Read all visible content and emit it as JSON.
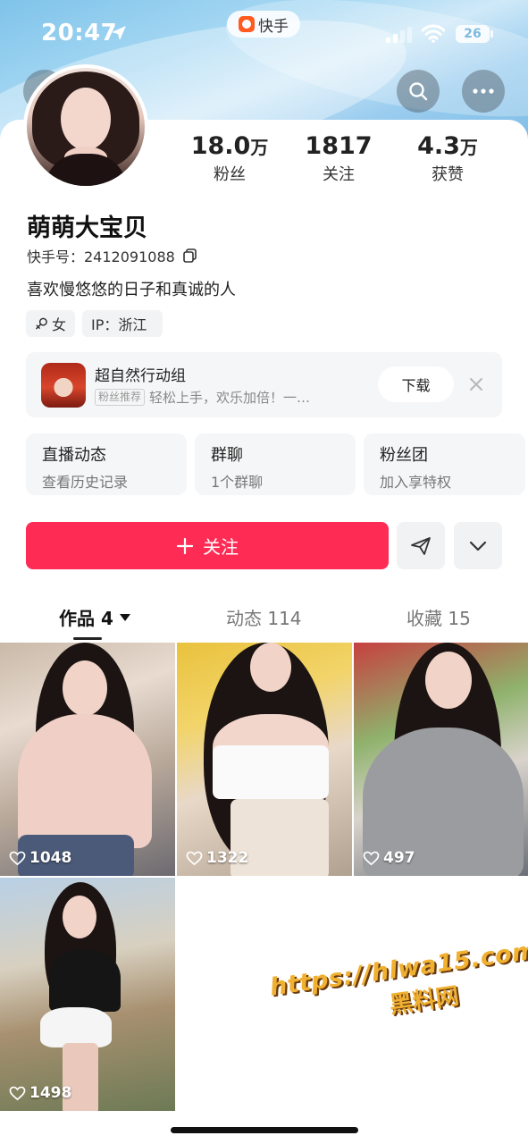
{
  "status_bar": {
    "time": "20:47",
    "app_name": "快手",
    "battery": "26",
    "icons": [
      "location-arrow-icon",
      "signal-icon",
      "wifi-icon",
      "battery-icon"
    ]
  },
  "header": {
    "icons": [
      "back-icon",
      "search-icon",
      "more-icon"
    ]
  },
  "profile": {
    "stats": [
      {
        "value": "18.0",
        "unit": "万",
        "label": "粉丝"
      },
      {
        "value": "1817",
        "unit": "",
        "label": "关注"
      },
      {
        "value": "4.3",
        "unit": "万",
        "label": "获赞"
      }
    ],
    "username": "萌萌大宝贝",
    "uid": "快手号：2412091088",
    "bio": "喜欢慢悠悠的日子和真诚的人",
    "tags": {
      "gender": "女",
      "ip": "IP：浙江"
    }
  },
  "promo": {
    "title": "超自然行动组",
    "badge": "粉丝推荐",
    "subtitle": "轻松上手，欢乐加倍！一…",
    "download_label": "下载"
  },
  "features": [
    {
      "title": "直播动态",
      "subtitle": "查看历史记录"
    },
    {
      "title": "群聊",
      "subtitle": "1个群聊"
    },
    {
      "title": "粉丝团",
      "subtitle": "加入享特权"
    }
  ],
  "actions": {
    "follow_label": "关注"
  },
  "tabs": [
    {
      "label": "作品 4"
    },
    {
      "label": "动态 114"
    },
    {
      "label": "收藏 15"
    }
  ],
  "videos": [
    {
      "likes": "1048"
    },
    {
      "likes": "1322"
    },
    {
      "likes": "497"
    },
    {
      "likes": "1498"
    }
  ],
  "watermark": {
    "url": "https://hlwa15.com",
    "name": "黑料网"
  },
  "colors": {
    "accent": "#fe2c55",
    "header_sky": "#8fcbee",
    "watermark": "#f0b030"
  }
}
